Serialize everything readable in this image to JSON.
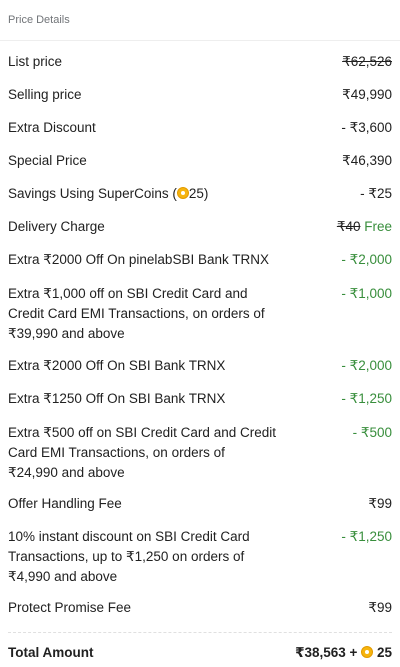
{
  "header": {
    "title": "Price Details"
  },
  "rows": [
    {
      "label": "List price",
      "value": "₹62,526"
    },
    {
      "label": "Selling price",
      "value": "₹49,990"
    },
    {
      "label": "Extra Discount",
      "value": "- ₹3,600"
    },
    {
      "label": "Special Price",
      "value": "₹46,390"
    },
    {
      "label_prefix": "Savings Using SuperCoins (",
      "coins": "25",
      "label_suffix": ")",
      "value": "- ₹25"
    },
    {
      "label": "Delivery Charge",
      "value_strike": "₹40",
      "value_free": "Free"
    },
    {
      "label": "Extra ₹2000 Off On pinelabSBI Bank TRNX",
      "value": "- ₹2,000"
    },
    {
      "label": "Extra ₹1,000 off on SBI Credit Card and Credit Card EMI Transactions, on orders of ₹39,990 and above",
      "value": "- ₹1,000"
    },
    {
      "label": "Extra ₹2000 Off On SBI Bank TRNX",
      "value": "- ₹2,000"
    },
    {
      "label": "Extra ₹1250 Off On SBI Bank TRNX",
      "value": "- ₹1,250"
    },
    {
      "label": "Extra ₹500 off on SBI Credit Card and Credit Card EMI Transactions, on orders of ₹24,990 and above",
      "value": "- ₹500"
    },
    {
      "label": "Offer Handling Fee",
      "value": "₹99"
    },
    {
      "label": "10% instant discount on SBI Credit Card Transactions, up to ₹1,250 on orders of ₹4,990 and above",
      "value": "- ₹1,250"
    },
    {
      "label": "Protect Promise Fee",
      "value": "₹99"
    }
  ],
  "total": {
    "label": "Total Amount",
    "value": "₹38,563 +",
    "coins": "25"
  },
  "colors": {
    "discount_green": "#388e3c",
    "muted_text": "#717478",
    "coin": "#f6b40e"
  },
  "icons": {
    "supercoin": "supercoin-icon"
  }
}
